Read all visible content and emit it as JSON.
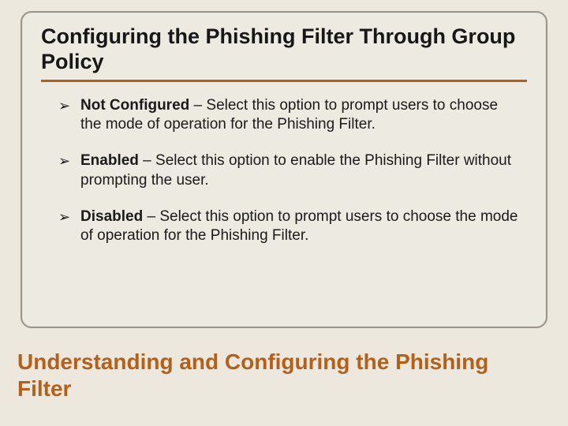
{
  "card": {
    "title": "Configuring the Phishing Filter Through Group Policy",
    "bullets": [
      {
        "marker": "➢",
        "label": "Not Configured",
        "sep": " – ",
        "desc": "Select this option to prompt users to choose the mode of operation for the Phishing Filter."
      },
      {
        "marker": "➢",
        "label": "Enabled",
        "sep": " – ",
        "desc": "Select this option to enable the Phishing Filter without prompting the user."
      },
      {
        "marker": "➢",
        "label": "Disabled",
        "sep": " – ",
        "desc": "Select this option to prompt users to choose the mode of operation for the Phishing Filter."
      }
    ]
  },
  "footer": {
    "title": "Understanding and Configuring the Phishing Filter"
  }
}
